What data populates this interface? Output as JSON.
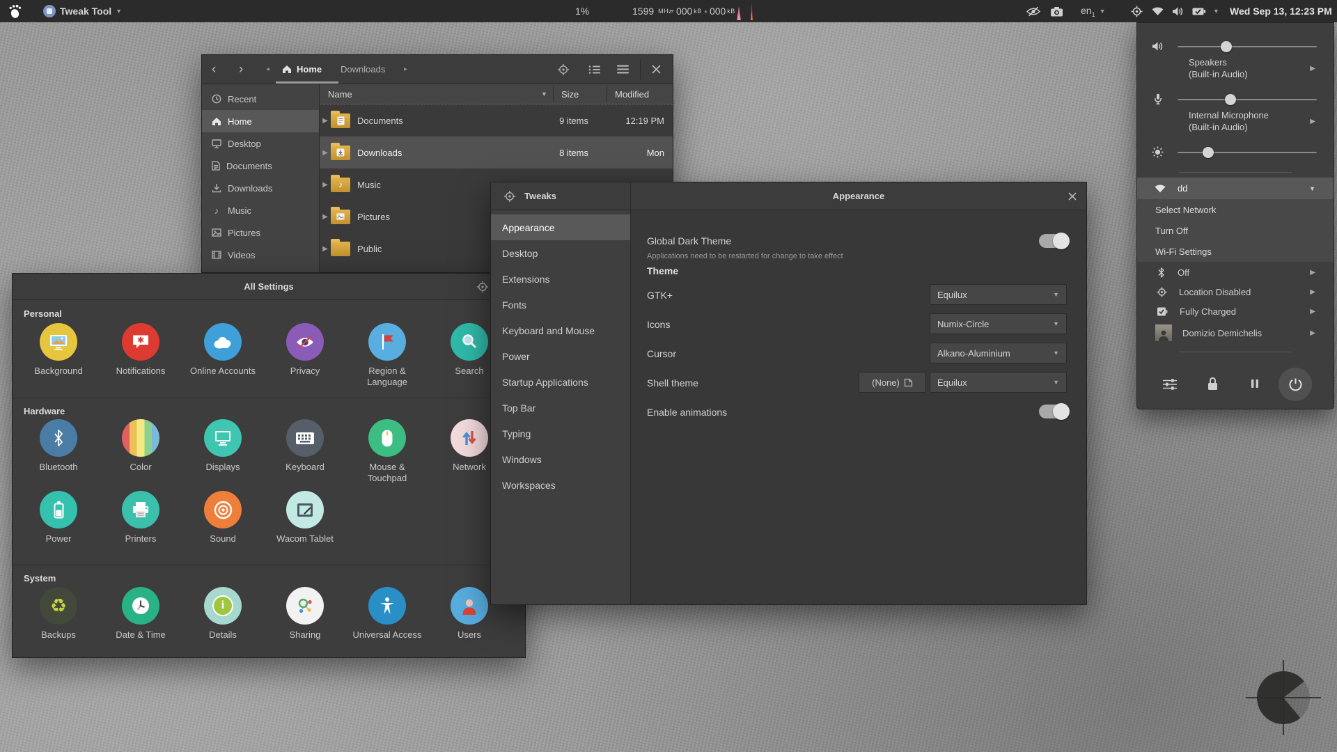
{
  "topbar": {
    "app_menu_label": "Tweak Tool",
    "cpu_load": "1%",
    "cpu_freq": "1599",
    "cpu_freq_unit": "MHz",
    "net_down": "000",
    "net_down_unit": "kB",
    "net_up": "000",
    "net_up_unit": "kB",
    "keyboard_layout": "en",
    "keyboard_layout_index": "1",
    "clock": "Wed Sep 13, 12:23 PM"
  },
  "file_manager": {
    "breadcrumb": {
      "home": "Home",
      "downloads": "Downloads"
    },
    "columns": {
      "name": "Name",
      "size": "Size",
      "modified": "Modified"
    },
    "sidebar": [
      {
        "label": "Recent"
      },
      {
        "label": "Home"
      },
      {
        "label": "Desktop"
      },
      {
        "label": "Documents"
      },
      {
        "label": "Downloads"
      },
      {
        "label": "Music"
      },
      {
        "label": "Pictures"
      },
      {
        "label": "Videos"
      }
    ],
    "rows": [
      {
        "name": "Documents",
        "size": "9 items",
        "modified": "12:19 PM"
      },
      {
        "name": "Downloads",
        "size": "8 items",
        "modified": "Mon"
      },
      {
        "name": "Music",
        "size": "",
        "modified": ""
      },
      {
        "name": "Pictures",
        "size": "",
        "modified": ""
      },
      {
        "name": "Public",
        "size": "",
        "modified": ""
      }
    ]
  },
  "settings": {
    "title": "All Settings",
    "sections": [
      {
        "label": "Personal",
        "items": [
          {
            "label": "Background",
            "color": "#e7c63f"
          },
          {
            "label": "Notifications",
            "color": "#dd3b32"
          },
          {
            "label": "Online Accounts",
            "color": "#3f9fd8"
          },
          {
            "label": "Privacy",
            "color": "#8a5cb8"
          },
          {
            "label": "Region & Language",
            "color": "#58aede"
          },
          {
            "label": "Search",
            "color": "#2fb9a9"
          }
        ]
      },
      {
        "label": "Hardware",
        "items": [
          {
            "label": "Bluetooth",
            "color": "#4a7da5"
          },
          {
            "label": "Color",
            "color": "#cccccc"
          },
          {
            "label": "Displays",
            "color": "#3fc6b0"
          },
          {
            "label": "Keyboard",
            "color": "#565e69"
          },
          {
            "label": "Mouse & Touchpad",
            "color": "#3cbd82"
          },
          {
            "label": "Network",
            "color": "#f2dadd"
          },
          {
            "label": "Power",
            "color": "#35c1ad"
          },
          {
            "label": "Printers",
            "color": "#3bc0ac"
          },
          {
            "label": "Sound",
            "color": "#ee7f3b"
          },
          {
            "label": "Wacom Tablet",
            "color": "#c2e9e3"
          }
        ]
      },
      {
        "label": "System",
        "items": [
          {
            "label": "Backups",
            "color": "#42483a"
          },
          {
            "label": "Date & Time",
            "color": "#28b286"
          },
          {
            "label": "Details",
            "color": "#a6d8cf"
          },
          {
            "label": "Sharing",
            "color": "#f2f2f2"
          },
          {
            "label": "Universal Access",
            "color": "#2b8fc7"
          },
          {
            "label": "Users",
            "color": "#57addf"
          }
        ]
      }
    ]
  },
  "tweaks": {
    "title": "Tweaks",
    "panel_title": "Appearance",
    "sidebar": [
      {
        "label": "Appearance"
      },
      {
        "label": "Desktop"
      },
      {
        "label": "Extensions"
      },
      {
        "label": "Fonts"
      },
      {
        "label": "Keyboard and Mouse"
      },
      {
        "label": "Power"
      },
      {
        "label": "Startup Applications"
      },
      {
        "label": "Top Bar"
      },
      {
        "label": "Typing"
      },
      {
        "label": "Windows"
      },
      {
        "label": "Workspaces"
      }
    ],
    "global_dark_theme": {
      "label": "Global Dark Theme",
      "hint": "Applications need to be restarted for change to take effect",
      "enabled": true
    },
    "theme_header": "Theme",
    "gtk": {
      "label": "GTK+",
      "value": "Equilux"
    },
    "icons": {
      "label": "Icons",
      "value": "Numix-Circle"
    },
    "cursor": {
      "label": "Cursor",
      "value": "Alkano-Aluminium"
    },
    "shell": {
      "label": "Shell theme",
      "button": "(None)",
      "value": "Equilux"
    },
    "animations": {
      "label": "Enable animations",
      "enabled": true
    }
  },
  "system_menu": {
    "volume": {
      "percent": 35
    },
    "microphone": {
      "percent": 38
    },
    "brightness": {
      "percent": 22
    },
    "output_device": {
      "label": "Speakers",
      "sublabel": "(Built-in Audio)"
    },
    "input_device": {
      "label": "Internal Microphone",
      "sublabel": "(Built-in Audio)"
    },
    "network": {
      "name": "dd",
      "items": [
        {
          "label": "Select Network"
        },
        {
          "label": "Turn Off"
        },
        {
          "label": "Wi-Fi Settings"
        }
      ]
    },
    "statuses": [
      {
        "label": "Off"
      },
      {
        "label": "Location Disabled"
      },
      {
        "label": "Fully Charged"
      },
      {
        "label": "Domizio Demichelis"
      }
    ]
  }
}
